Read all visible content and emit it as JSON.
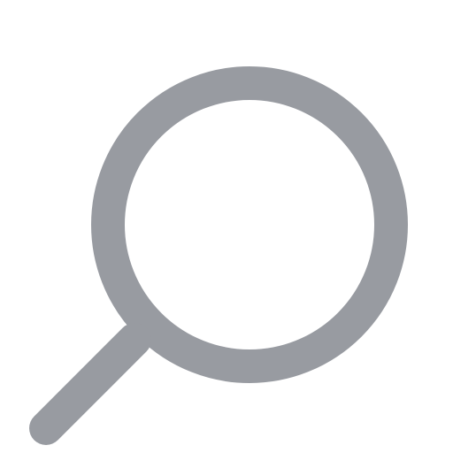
{
  "icon": {
    "name": "search-icon",
    "color": "#989ba1",
    "background": "#ffffff"
  }
}
